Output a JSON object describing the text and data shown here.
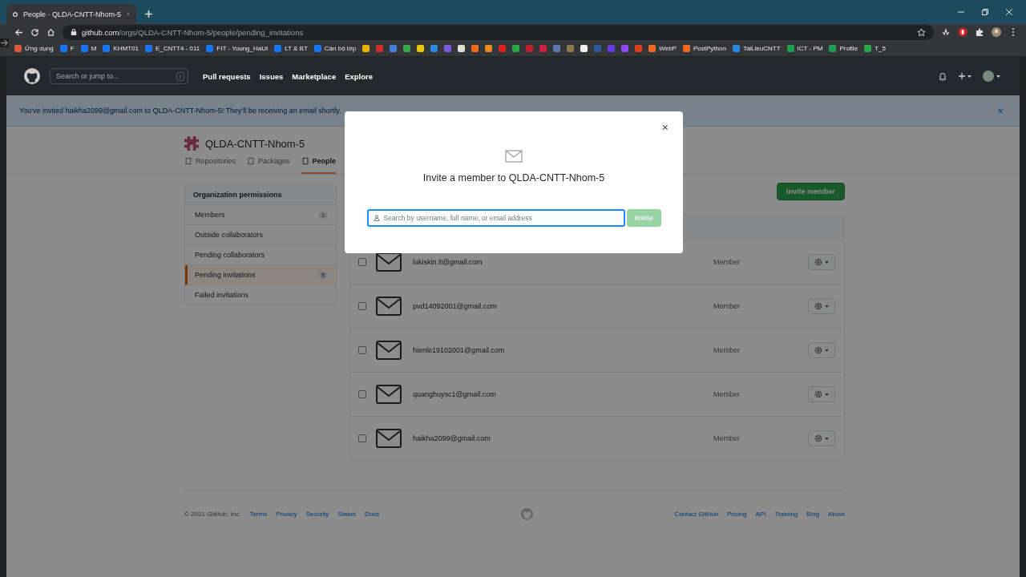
{
  "browser": {
    "tab_title": "People · QLDA-CNTT-Nhom-5",
    "url_host": "github.com",
    "url_path": "/orgs/QLDA-CNTT-Nhom-5/people/pending_invitations",
    "bookmarks": [
      {
        "label": "Ứng dụng",
        "color": "#e0583a"
      },
      {
        "label": "F",
        "color": "#1877f2"
      },
      {
        "label": "M",
        "color": "#1877f2"
      },
      {
        "label": "KHMT01",
        "color": "#1877f2"
      },
      {
        "label": "E_CNTT4 - 011",
        "color": "#1877f2"
      },
      {
        "label": "FIT - Young_HaUI",
        "color": "#1877f2"
      },
      {
        "label": "LT & BT",
        "color": "#1877f2"
      },
      {
        "label": "Cán bộ lớp",
        "color": "#1877f2"
      },
      {
        "color": "#e8b400"
      },
      {
        "color": "#d02c2c"
      },
      {
        "color": "#4a7fe0"
      },
      {
        "color": "#3aa84a"
      },
      {
        "color": "#e8c800"
      },
      {
        "color": "#2a8ae0"
      },
      {
        "color": "#7a5ae0"
      },
      {
        "color": "#e0e0d0"
      },
      {
        "color": "#f06a20"
      },
      {
        "color": "#e88a20"
      },
      {
        "color": "#e02020"
      },
      {
        "color": "#2aa84a"
      },
      {
        "color": "#c02030"
      },
      {
        "color": "#d02040"
      },
      {
        "color": "#5a7ab0"
      },
      {
        "color": "#8a7a50"
      },
      {
        "color": "#f0f0f0"
      },
      {
        "color": "#2a5a9a"
      },
      {
        "color": "#6a3ae0"
      },
      {
        "color": "#9146ff"
      },
      {
        "color": "#e04020"
      },
      {
        "label": "WebP",
        "color": "#f06a20"
      },
      {
        "label": "PostPython",
        "color": "#f06a20"
      },
      {
        "label": "TaiLieuCNTT",
        "color": "#2a8ae0"
      },
      {
        "label": "ICT - PM",
        "color": "#1ea050"
      },
      {
        "label": "Profile",
        "color": "#1ea050"
      },
      {
        "label": "T_5",
        "color": "#2aa84a"
      }
    ]
  },
  "header": {
    "search_placeholder": "Search or jump to...",
    "search_key": "/",
    "nav": [
      "Pull requests",
      "Issues",
      "Marketplace",
      "Explore"
    ]
  },
  "flash": {
    "message": "You've invited haikha2099@gmail.com to QLDA-CNTT-Nhom-5! They'll be receiving an email shortly.",
    "close": "×"
  },
  "org": {
    "name": "QLDA-CNTT-Nhom-5",
    "tabs": [
      {
        "label": "Repositories",
        "selected": false
      },
      {
        "label": "Packages",
        "selected": false
      },
      {
        "label": "People",
        "selected": true
      }
    ]
  },
  "sidebar": {
    "heading": "Organization permissions",
    "items": [
      {
        "label": "Members",
        "count": "1",
        "selected": false
      },
      {
        "label": "Outside collaborators",
        "selected": false
      },
      {
        "label": "Pending collaborators",
        "selected": false
      },
      {
        "label": "Pending invitations",
        "count": "5",
        "selected": true
      },
      {
        "label": "Failed invitations",
        "selected": false
      }
    ]
  },
  "invite_button": "Invite member",
  "invitations": [
    {
      "email": "lokiskin.lt@gmail.com",
      "role": "Member",
      "checked": false
    },
    {
      "email": "pvd14092001@gmail.com",
      "role": "Member",
      "checked": false
    },
    {
      "email": "hienle19102001@gmail.com",
      "role": "Member",
      "checked": false
    },
    {
      "email": "quanghuysc1@gmail.com",
      "role": "Member",
      "checked": false
    },
    {
      "email": "haikha2099@gmail.com",
      "role": "Member",
      "checked": false
    }
  ],
  "footer": {
    "copyright": "© 2021 GitHub, Inc.",
    "left_links": [
      "Terms",
      "Privacy",
      "Security",
      "Status",
      "Docs"
    ],
    "right_links": [
      "Contact GitHub",
      "Pricing",
      "API",
      "Training",
      "Blog",
      "About"
    ]
  },
  "modal": {
    "title": "Invite a member to QLDA-CNTT-Nhom-5",
    "close": "×",
    "placeholder": "Search by username, full name, or email address",
    "button": "Invite",
    "button_disabled": true
  }
}
